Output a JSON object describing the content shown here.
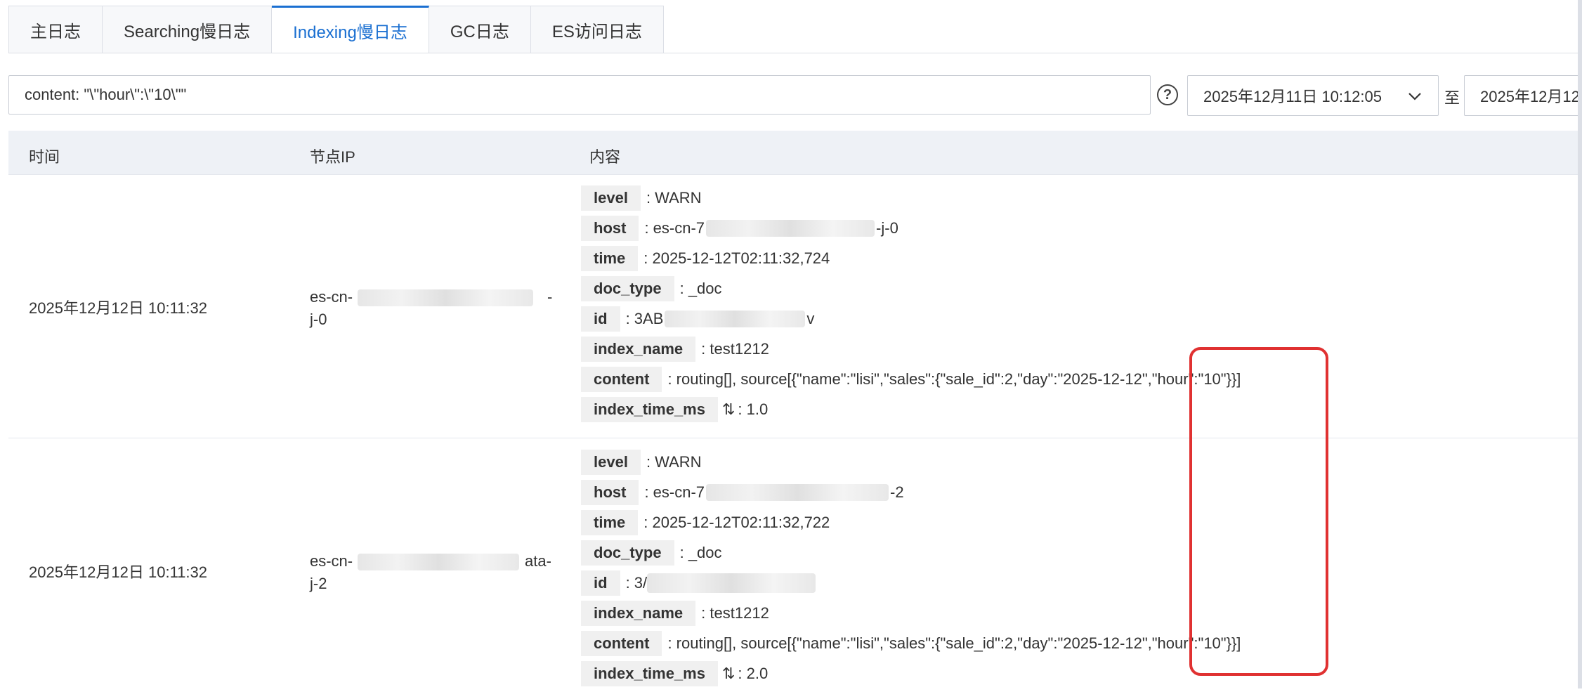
{
  "tabs": [
    {
      "label": "主日志",
      "active": false
    },
    {
      "label": "Searching慢日志",
      "active": false
    },
    {
      "label": "Indexing慢日志",
      "active": true
    },
    {
      "label": "GC日志",
      "active": false
    },
    {
      "label": "ES访问日志",
      "active": false
    }
  ],
  "search": {
    "value": "content: \"\\\"hour\\\":\\\"10\\\"\""
  },
  "help_icon": "?",
  "date_range": {
    "start": "2025年12月11日 10:12:05",
    "separator": "至",
    "end": "2025年12月12"
  },
  "table": {
    "headers": {
      "time": "时间",
      "node_ip": "节点IP",
      "content": "内容"
    },
    "rows": [
      {
        "time": "2025年12月12日 10:11:32",
        "node_ip_line1": "es-cn-",
        "node_ip_line1_tail": "-",
        "node_ip_line2": "j-0",
        "fields": [
          {
            "key": "level",
            "value": ": WARN"
          },
          {
            "key": "host",
            "value": ": es-cn-7",
            "tail": "-j-0"
          },
          {
            "key": "time",
            "value": ": 2025-12-12T02:11:32,724"
          },
          {
            "key": "doc_type",
            "value": ": _doc"
          },
          {
            "key": "id",
            "value": ": 3AB",
            "tail": "v"
          },
          {
            "key": "index_name",
            "value": ": test1212"
          },
          {
            "key": "content",
            "value": ": routing[], source[{\"name\":\"lisi\",\"sales\":{\"sale_id\":2,\"day\":\"2025-12-12\",\"hour\":\"10\"}}]"
          },
          {
            "key": "index_time_ms",
            "value": ": 1.0",
            "sortable": true
          }
        ]
      },
      {
        "time": "2025年12月12日 10:11:32",
        "node_ip_line1": "es-cn-",
        "node_ip_line1_tail": "ata-",
        "node_ip_line2": "j-2",
        "fields": [
          {
            "key": "level",
            "value": ": WARN"
          },
          {
            "key": "host",
            "value": ": es-cn-7",
            "tail": "-2"
          },
          {
            "key": "time",
            "value": ": 2025-12-12T02:11:32,722"
          },
          {
            "key": "doc_type",
            "value": ": _doc"
          },
          {
            "key": "id",
            "value": ": 3/"
          },
          {
            "key": "index_name",
            "value": ": test1212"
          },
          {
            "key": "content",
            "value": ": routing[], source[{\"name\":\"lisi\",\"sales\":{\"sale_id\":2,\"day\":\"2025-12-12\",\"hour\":\"10\"}}]"
          },
          {
            "key": "index_time_ms",
            "value": ": 2.0",
            "sortable": true
          }
        ]
      }
    ]
  },
  "icons": {
    "chevron": "chevron-down-icon",
    "sort": "sort-icon",
    "help": "help-icon"
  },
  "colors": {
    "accent": "#1a6fd1",
    "highlight": "#e03131",
    "header_bg": "#eef1f6",
    "key_bg": "#f0f0f0"
  }
}
